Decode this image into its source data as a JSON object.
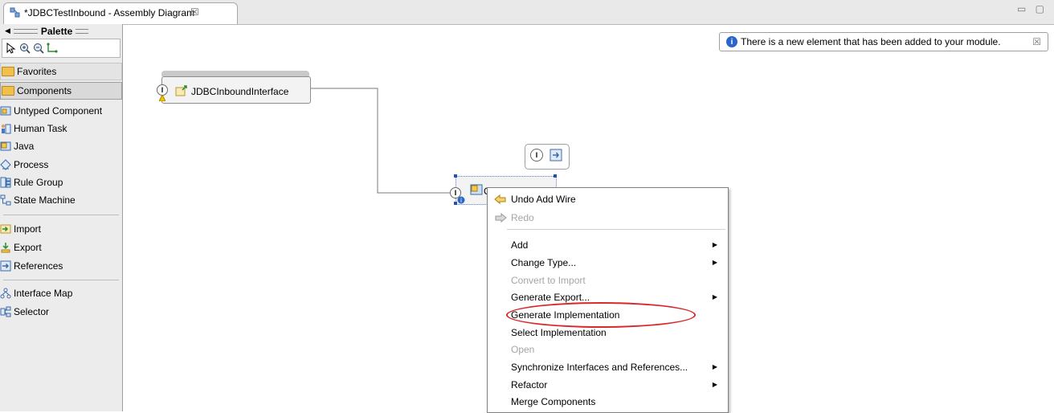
{
  "editor": {
    "tab_title": "*JDBCTestInbound - Assembly Diagram",
    "tab_close": "☒",
    "window_controls": "▭ ▢"
  },
  "palette": {
    "title": "Palette",
    "drawers": [
      {
        "label": "Favorites"
      },
      {
        "label": "Components"
      }
    ],
    "items": [
      {
        "label": "Untyped Component",
        "icon": "untyped-component-icon"
      },
      {
        "label": "Human Task",
        "icon": "human-task-icon"
      },
      {
        "label": "Java",
        "icon": "java-icon"
      },
      {
        "label": "Process",
        "icon": "process-icon"
      },
      {
        "label": "Rule Group",
        "icon": "rule-group-icon"
      },
      {
        "label": "State Machine",
        "icon": "state-machine-icon"
      },
      {
        "label": "Import",
        "icon": "import-icon"
      },
      {
        "label": "Export",
        "icon": "export-icon"
      },
      {
        "label": "References",
        "icon": "references-icon"
      },
      {
        "label": "Interface Map",
        "icon": "interface-map-icon"
      },
      {
        "label": "Selector",
        "icon": "selector-icon"
      }
    ]
  },
  "canvas": {
    "notification": "There is a new element that has been added to your module.",
    "notification_close": "☒",
    "export_node_label": "JDBCInboundInterface",
    "component_label": "C",
    "badge_letter": "I"
  },
  "context_menu": {
    "items": [
      {
        "label": "Undo Add Wire",
        "disabled": false,
        "submenu": false
      },
      {
        "label": "Redo",
        "disabled": true,
        "submenu": false
      },
      {
        "label": "Add",
        "disabled": false,
        "submenu": true
      },
      {
        "label": "Change Type...",
        "disabled": false,
        "submenu": true
      },
      {
        "label": "Convert to Import",
        "disabled": true,
        "submenu": false
      },
      {
        "label": "Generate Export...",
        "disabled": false,
        "submenu": true
      },
      {
        "label": "Generate Implementation",
        "disabled": false,
        "submenu": false
      },
      {
        "label": "Select Implementation",
        "disabled": false,
        "submenu": false
      },
      {
        "label": "Open",
        "disabled": true,
        "submenu": false
      },
      {
        "label": "Synchronize Interfaces and References...",
        "disabled": false,
        "submenu": true
      },
      {
        "label": "Refactor",
        "disabled": false,
        "submenu": true
      },
      {
        "label": "Merge Components",
        "disabled": false,
        "submenu": false
      }
    ],
    "highlighted_item": "Generate Implementation",
    "highlight_color": "#d8282b",
    "submenu_arrow": "▶"
  }
}
